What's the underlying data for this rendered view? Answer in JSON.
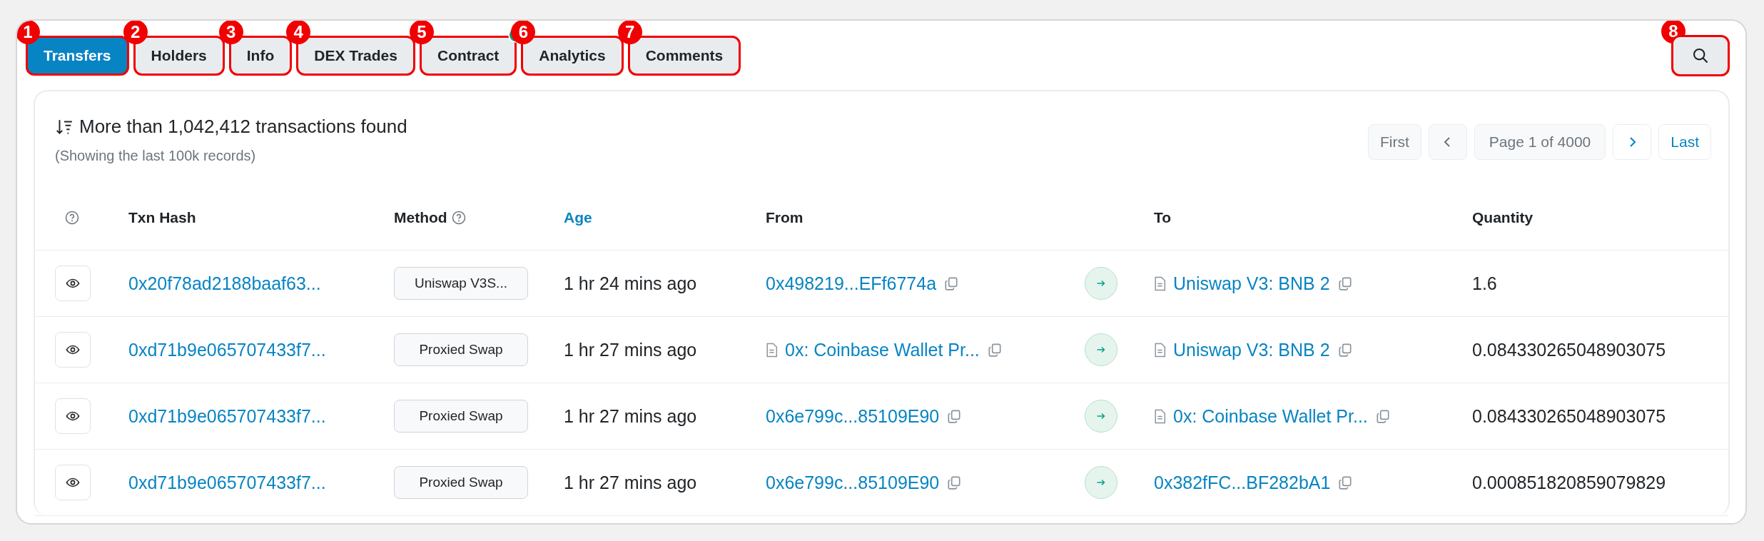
{
  "tabs": [
    {
      "label": "Transfers",
      "selected": true,
      "callout": "1"
    },
    {
      "label": "Holders",
      "selected": false,
      "callout": "2"
    },
    {
      "label": "Info",
      "selected": false,
      "callout": "3"
    },
    {
      "label": "DEX Trades",
      "selected": false,
      "callout": "4"
    },
    {
      "label": "Contract",
      "selected": false,
      "callout": "5",
      "verified": true
    },
    {
      "label": "Analytics",
      "selected": false,
      "callout": "6"
    },
    {
      "label": "Comments",
      "selected": false,
      "callout": "7"
    }
  ],
  "search_button": {
    "callout": "8"
  },
  "summary": {
    "title": "More than 1,042,412 transactions found",
    "subtitle": "(Showing the last 100k records)"
  },
  "pagination": [
    {
      "kind": "button",
      "label": "First",
      "disabled": true
    },
    {
      "kind": "prev",
      "disabled": true
    },
    {
      "kind": "page",
      "label": "Page 1 of 4000"
    },
    {
      "kind": "next",
      "disabled": false
    },
    {
      "kind": "button",
      "label": "Last",
      "disabled": false
    }
  ],
  "columns": [
    {
      "label": "Txn Hash",
      "link": false
    },
    {
      "label": "Method",
      "help": true,
      "link": false
    },
    {
      "label": "Age",
      "link": true
    },
    {
      "label": "From",
      "link": false
    },
    {
      "label": "To",
      "link": false
    },
    {
      "label": "Quantity",
      "link": false
    }
  ],
  "rows": [
    {
      "hash": "0x20f78ad2188baaf63...",
      "method": "Uniswap V3S...",
      "age": "1 hr 24 mins ago",
      "from": {
        "text": "0x498219...EFf6774a"
      },
      "to": {
        "text": "Uniswap V3: BNB 2",
        "contract": true
      },
      "quantity": "1.6"
    },
    {
      "hash": "0xd71b9e065707433f7...",
      "method": "Proxied Swap",
      "age": "1 hr 27 mins ago",
      "from": {
        "text": "0x: Coinbase Wallet Pr...",
        "contract": true
      },
      "to": {
        "text": "Uniswap V3: BNB 2",
        "contract": true
      },
      "quantity": "0.084330265048903075"
    },
    {
      "hash": "0xd71b9e065707433f7...",
      "method": "Proxied Swap",
      "age": "1 hr 27 mins ago",
      "from": {
        "text": "0x6e799c...85109E90"
      },
      "to": {
        "text": "0x: Coinbase Wallet Pr...",
        "contract": true
      },
      "quantity": "0.084330265048903075"
    },
    {
      "hash": "0xd71b9e065707433f7...",
      "method": "Proxied Swap",
      "age": "1 hr 27 mins ago",
      "from": {
        "text": "0x6e799c...85109E90"
      },
      "to": {
        "text": "0x382fFC...BF282bA1"
      },
      "quantity": "0.000851820859079829"
    }
  ]
}
